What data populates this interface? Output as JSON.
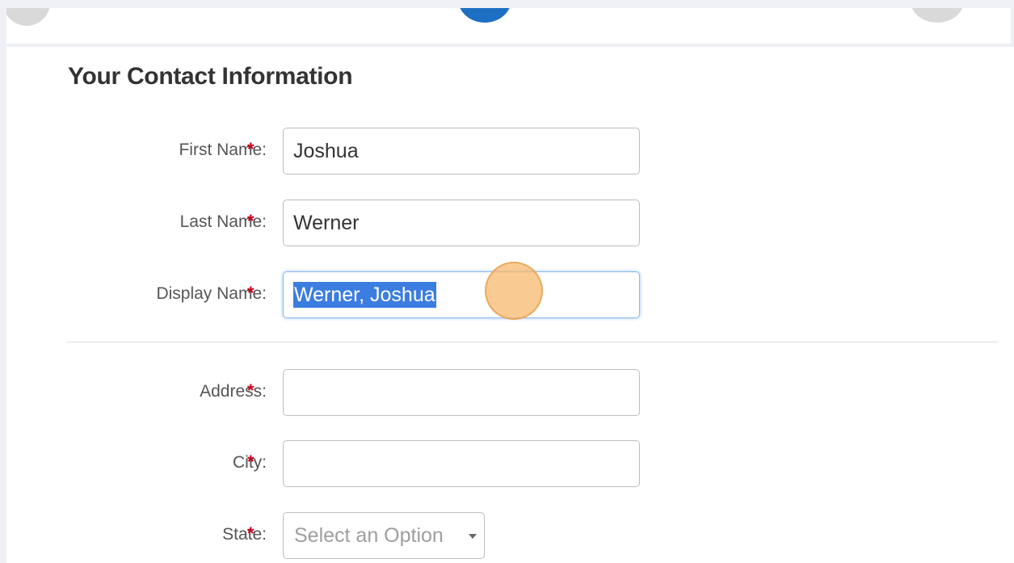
{
  "form": {
    "title": "Your Contact Information",
    "required_marker": "*",
    "fields": {
      "first_name": {
        "label": "First Name:",
        "value": "Joshua"
      },
      "last_name": {
        "label": "Last Name:",
        "value": "Werner"
      },
      "display_name": {
        "label": "Display Name:",
        "value": "Werner, Joshua"
      },
      "address": {
        "label": "Address:",
        "value": ""
      },
      "city": {
        "label": "City:",
        "value": ""
      },
      "state": {
        "label": "State:",
        "selected": "Select an Option"
      }
    }
  },
  "colors": {
    "accent": "#1d6fc4",
    "required": "#d0021b",
    "selection": "#3b7de0",
    "click_marker": "#f7ba6e"
  }
}
